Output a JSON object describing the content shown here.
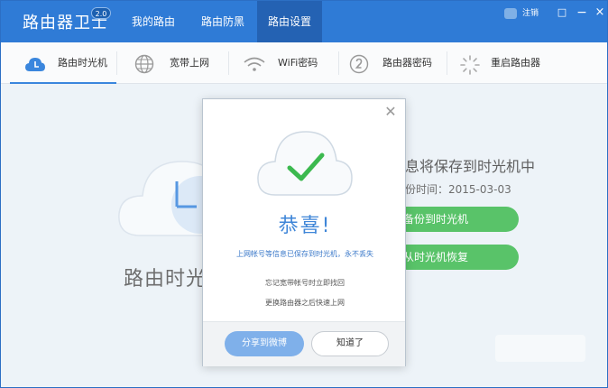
{
  "app": {
    "title": "路由器卫士",
    "version": "2.0"
  },
  "nav": {
    "tabs": [
      {
        "label": "我的路由"
      },
      {
        "label": "路由防黑"
      },
      {
        "label": "路由设置"
      }
    ],
    "active_tab": "路由设置"
  },
  "user": {
    "logout_label": "注销"
  },
  "window_controls": {
    "restore": "□",
    "minimize": "−",
    "close": "×"
  },
  "subtabs": [
    {
      "label": "路由时光机",
      "icon": "time-machine-cloud-icon"
    },
    {
      "label": "宽带上网",
      "icon": "globe-icon"
    },
    {
      "label": "WiFi密码",
      "icon": "wifi-icon"
    },
    {
      "label": "路由器密码",
      "icon": "password-icon"
    },
    {
      "label": "重启路由器",
      "icon": "restart-spinner-icon"
    }
  ],
  "background": {
    "title": "路由时光",
    "headline": "息将保存到时光机中",
    "time_label": "份时间：2015-03-03",
    "backup_button": "备份到时光机",
    "restore_button": "从时光机恢复"
  },
  "dialog": {
    "title": "恭喜!",
    "message": "上网帐号等信息已保存到时光机，永不丢失",
    "tip1": "忘记宽带帐号时立即找回",
    "tip2": "更换路由器之后快速上网",
    "share_button": "分享到微博",
    "ok_button": "知道了"
  },
  "colors": {
    "titlebar": "#2f7bd6",
    "active_tab": "#2462b3",
    "accent_blue": "#3f86d8",
    "success_green": "#3cb94f"
  }
}
